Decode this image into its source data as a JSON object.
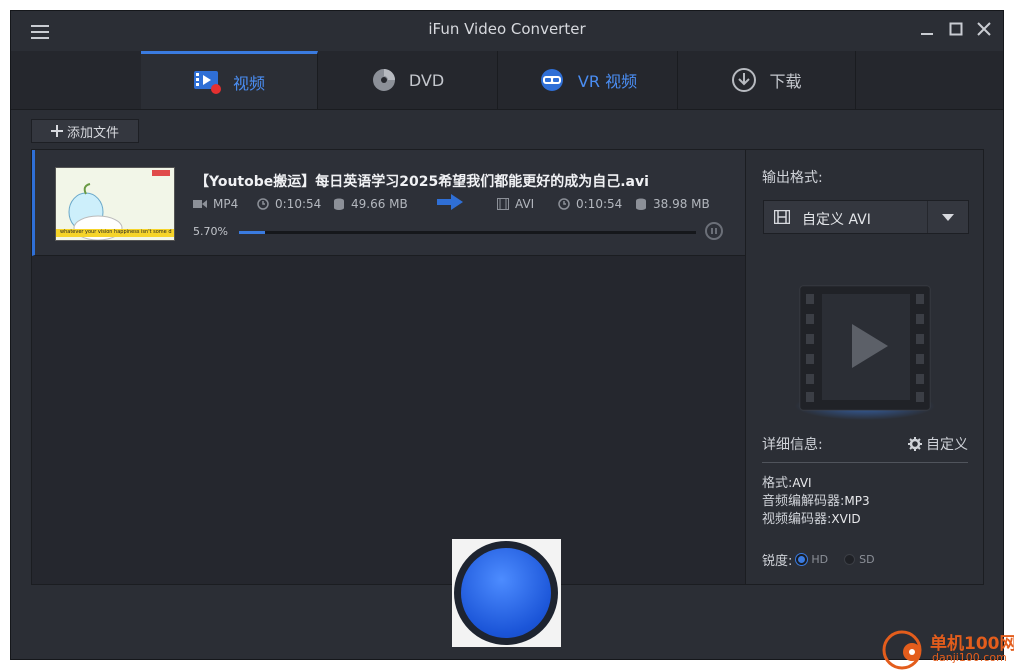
{
  "app": {
    "title": "iFun Video Converter"
  },
  "tabs": [
    {
      "label": "视频",
      "icon": "video-icon",
      "active": true
    },
    {
      "label": "DVD",
      "icon": "dvd-icon",
      "active": false
    },
    {
      "label": "VR 视频",
      "icon": "vr-headset-icon",
      "active": false
    },
    {
      "label": "下载",
      "icon": "download-icon",
      "active": false
    }
  ],
  "toolbar": {
    "add_file_label": "添加文件"
  },
  "file": {
    "name": "【Youtobe搬运】每日英语学习2025希望我们都能更好的成为自己.avi",
    "thumbnail_caption": "whatever your vision happiness isn't some distant goal",
    "source": {
      "format": "MP4",
      "duration": "0:10:54",
      "size": "49.66 MB"
    },
    "target": {
      "format": "AVI",
      "duration": "0:10:54",
      "size": "38.98 MB"
    },
    "progress_text": "5.70%",
    "progress_fraction": 0.057
  },
  "output": {
    "label": "输出格式:",
    "selected_format": "自定义 AVI",
    "details_label": "详细信息:",
    "custom_label": "自定义",
    "info": [
      {
        "key": "格式:",
        "value": "AVI"
      },
      {
        "key": "音频编解码器:",
        "value": "MP3"
      },
      {
        "key": "视频编码器:",
        "value": "XVID"
      }
    ],
    "sharpness_label": "锐度:",
    "sharpness_options": [
      "HD",
      "SD"
    ],
    "sharpness_selected": "HD"
  },
  "watermark": {
    "text": "单机100网",
    "sub": "danji100.com"
  },
  "colors": {
    "accent": "#3a7be0",
    "window_bg": "#2b2e35",
    "panel_bg": "#25272e",
    "convert_button": "#1b55d8"
  }
}
